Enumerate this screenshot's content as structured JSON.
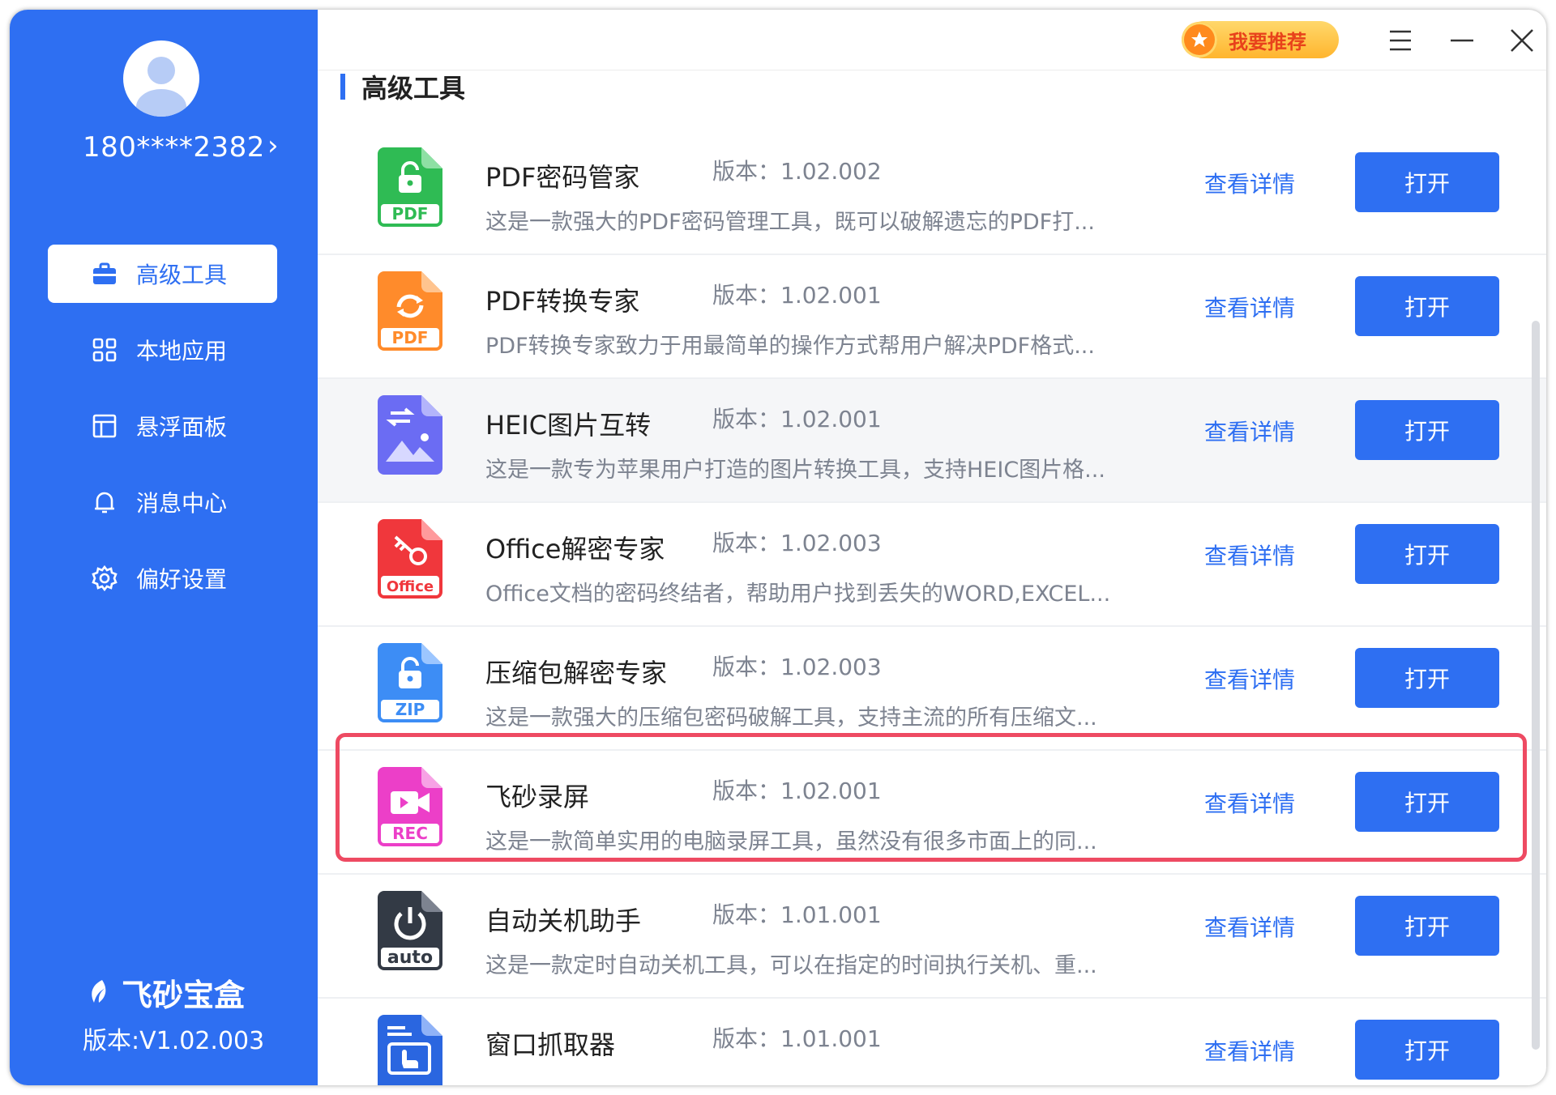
{
  "user": {
    "phone": "180****2382"
  },
  "nav": [
    {
      "label": "高级工具",
      "icon": "briefcase-icon",
      "active": true
    },
    {
      "label": "本地应用",
      "icon": "grid-icon",
      "active": false
    },
    {
      "label": "悬浮面板",
      "icon": "panel-icon",
      "active": false
    },
    {
      "label": "消息中心",
      "icon": "bell-icon",
      "active": false
    },
    {
      "label": "偏好设置",
      "icon": "gear-icon",
      "active": false
    }
  ],
  "brand": {
    "name": "飞砂宝盒",
    "version": "版本:V1.02.003"
  },
  "topbar": {
    "recommend_label": "我要推荐"
  },
  "section_title": "高级工具",
  "tools": [
    {
      "name": "PDF密码管家",
      "version": "版本：1.02.002",
      "desc": "这是一款强大的PDF密码管理工具，既可以破解遗忘的PDF打...",
      "badge": "PDF",
      "color": "#2fbb54",
      "icon": "pdf-lock-icon",
      "detail": "查看详情",
      "open": "打开"
    },
    {
      "name": "PDF转换专家",
      "version": "版本：1.02.001",
      "desc": "PDF转换专家致力于用最简单的操作方式帮用户解决PDF格式...",
      "badge": "PDF",
      "color": "#ff8b2b",
      "icon": "pdf-convert-icon",
      "detail": "查看详情",
      "open": "打开"
    },
    {
      "name": "HEIC图片互转",
      "version": "版本：1.02.001",
      "desc": "这是一款专为苹果用户打造的图片转换工具，支持HEIC图片格...",
      "badge": "",
      "color": "#6b6cf3",
      "icon": "heic-image-icon",
      "detail": "查看详情",
      "open": "打开"
    },
    {
      "name": "Office解密专家",
      "version": "版本：1.02.003",
      "desc": "Office文档的密码终结者，帮助用户找到丢失的WORD,EXCEL...",
      "badge": "Office",
      "color": "#f0373c",
      "icon": "office-key-icon",
      "detail": "查看详情",
      "open": "打开"
    },
    {
      "name": "压缩包解密专家",
      "version": "版本：1.02.003",
      "desc": "这是一款强大的压缩包密码破解工具，支持主流的所有压缩文...",
      "badge": "ZIP",
      "color": "#3d8df5",
      "icon": "zip-lock-icon",
      "detail": "查看详情",
      "open": "打开"
    },
    {
      "name": "飞砂录屏",
      "version": "版本：1.02.001",
      "desc": "这是一款简单实用的电脑录屏工具，虽然没有很多市面上的同...",
      "badge": "REC",
      "color": "#ec3fc8",
      "icon": "screen-record-icon",
      "detail": "查看详情",
      "open": "打开"
    },
    {
      "name": "自动关机助手",
      "version": "版本：1.01.001",
      "desc": "这是一款定时自动关机工具，可以在指定的时间执行关机、重...",
      "badge": "auto",
      "color": "#333a45",
      "icon": "power-icon",
      "detail": "查看详情",
      "open": "打开"
    },
    {
      "name": "窗口抓取器",
      "version": "版本：1.01.001",
      "desc": "",
      "badge": "",
      "color": "#2a66e0",
      "icon": "window-grab-icon",
      "detail": "查看详情",
      "open": "打开"
    }
  ]
}
